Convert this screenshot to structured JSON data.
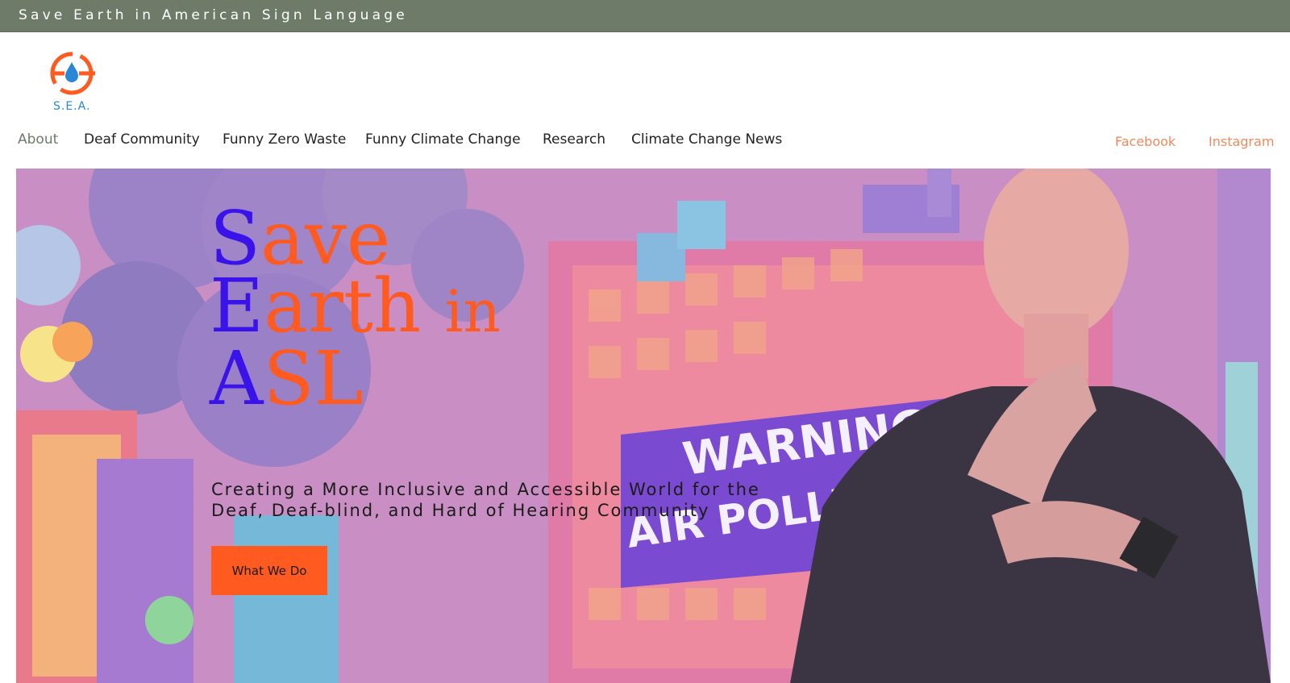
{
  "topbar": {
    "title": "Save Earth in American Sign Language"
  },
  "logo": {
    "text": "S.E.A.",
    "icon": "water-drop-globe-icon"
  },
  "nav": {
    "items": [
      {
        "label": "About",
        "active": true
      },
      {
        "label": "Deaf Community"
      },
      {
        "label": "Funny Zero Waste"
      },
      {
        "label": "Funny Climate Change"
      },
      {
        "label": "Research"
      },
      {
        "label": "Climate Change News"
      }
    ]
  },
  "social": {
    "facebook": "Facebook",
    "instagram": "Instagram"
  },
  "hero": {
    "headline": {
      "line1_cap": "S",
      "line1_rest": "ave",
      "line2_cap": "E",
      "line2_rest": "arth",
      "line2_tail": "in",
      "line3_cap": "A",
      "line3_rest": "SL"
    },
    "tagline_line1": "Creating a More Inclusive and Accessible World for the",
    "tagline_line2": "Deaf, Deaf-blind, and Hard of Hearing Community",
    "cta_label": "What We Do",
    "sign_text_1": "WARNING",
    "sign_text_2": "AIR POLLUTION"
  },
  "colors": {
    "topbar": "#6e7b69",
    "accent_orange": "#ff5a1f",
    "accent_blue": "#3a12ea",
    "social": "#f08a5d",
    "logo_blue": "#2a86d6"
  }
}
